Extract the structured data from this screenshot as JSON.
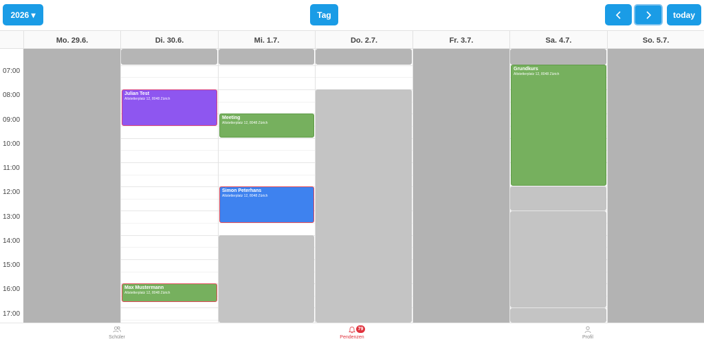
{
  "toolbar": {
    "year_button": "2026 ▾",
    "view_button": "Tag",
    "prev_icon": "chevron-left-icon",
    "next_icon": "chevron-right-icon",
    "today_button": "today"
  },
  "days": [
    {
      "label": "Mo. 29.6."
    },
    {
      "label": "Di. 30.6."
    },
    {
      "label": "Mi. 1.7."
    },
    {
      "label": "Do. 2.7."
    },
    {
      "label": "Fr. 3.7."
    },
    {
      "label": "Sa. 4.7."
    },
    {
      "label": "So. 5.7."
    }
  ],
  "hours": [
    "07:00",
    "08:00",
    "09:00",
    "10:00",
    "11:00",
    "12:00",
    "13:00",
    "14:00",
    "15:00",
    "16:00",
    "17:00"
  ],
  "events": {
    "julian": {
      "title": "Julian Test",
      "address": "Altstetterplatz 12, 8048 Zürich"
    },
    "meeting": {
      "title": "Meeting",
      "address": "Altstetterplatz 12, 8048 Zürich"
    },
    "simon": {
      "title": "Simon Peterhans",
      "address": "Altstetterplatz 12, 8048 Zürich"
    },
    "max": {
      "title": "Max Mustermann",
      "address": "Altstetterplatz 12, 8048 Zürich"
    },
    "grundkurs": {
      "title": "Grundkurs",
      "address": "Altstetterplatz 12, 8048 Zürich"
    }
  },
  "tabbar": {
    "students": {
      "label": "Schüler",
      "icon": "users-icon"
    },
    "tasks": {
      "label": "Pendenzen",
      "icon": "bell-icon",
      "badge": "79"
    },
    "profile": {
      "label": "Profil",
      "icon": "person-icon"
    }
  },
  "colors": {
    "accent": "#1a9ce6",
    "unavailable": "#b5b5b5",
    "event_purple": "#8e56f0",
    "event_green": "#76b05e",
    "event_blue": "#3e82ef",
    "badge": "#e0333e"
  }
}
